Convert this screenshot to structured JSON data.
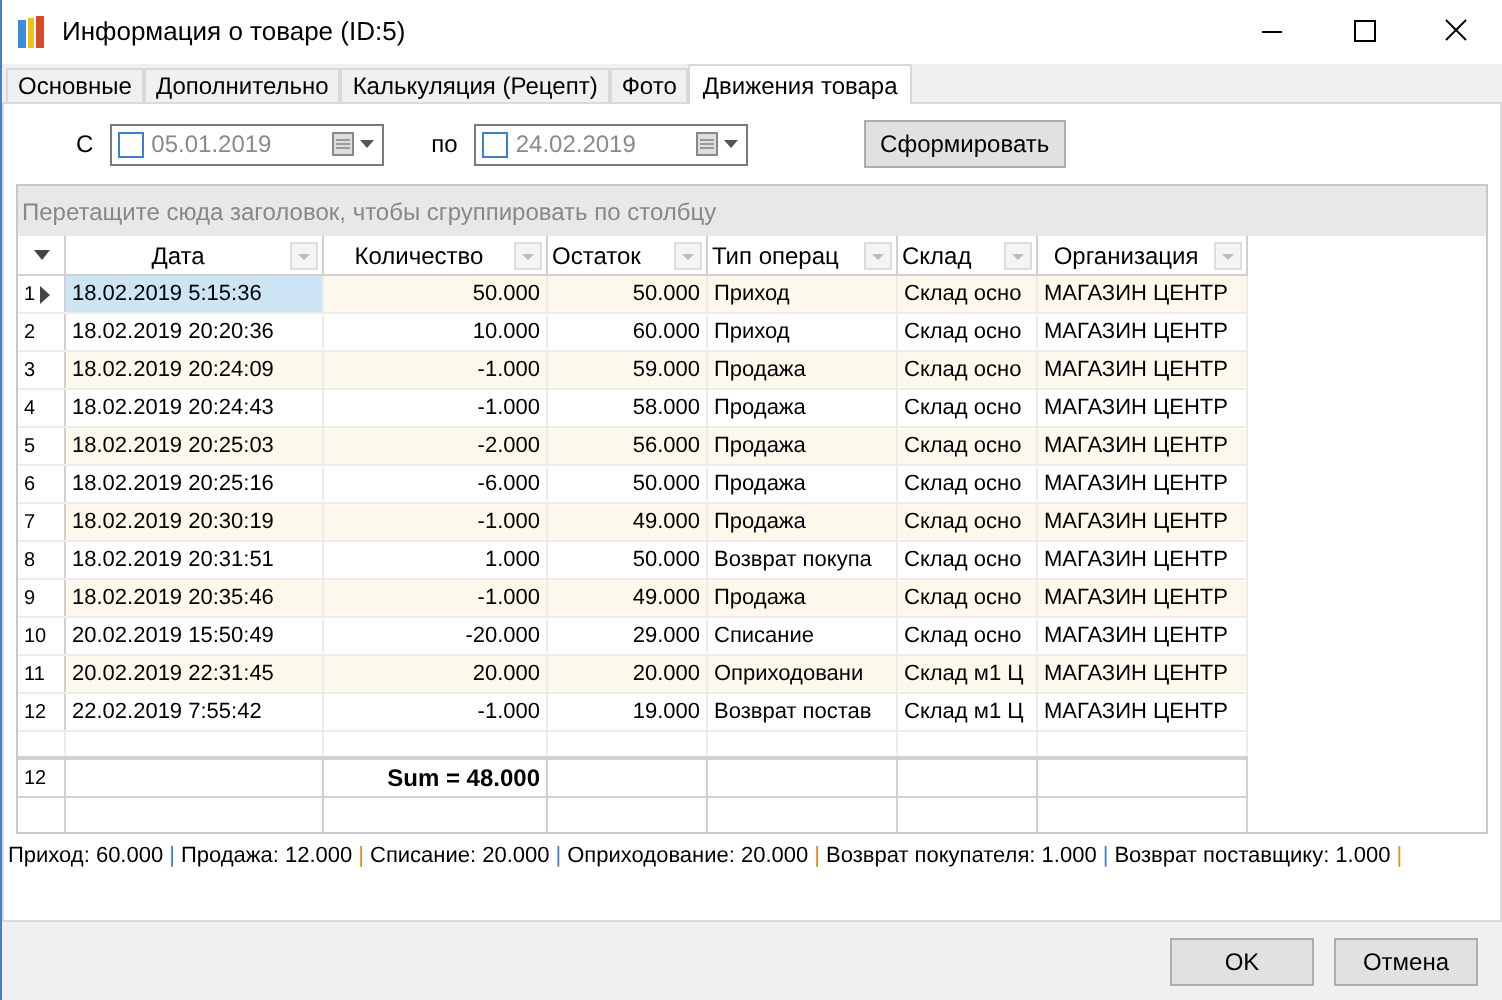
{
  "window": {
    "title": "Информация о товаре (ID:5)"
  },
  "tabs": [
    {
      "label": "Основные",
      "selected": false
    },
    {
      "label": "Дополнительно",
      "selected": false
    },
    {
      "label": "Калькуляция (Рецепт)",
      "selected": false
    },
    {
      "label": "Фото",
      "selected": false
    },
    {
      "label": "Движения товара",
      "selected": true
    }
  ],
  "filter": {
    "from_label": "С",
    "from_date": {
      "value": "05.01.2019",
      "checked": false
    },
    "to_label": "по",
    "to_date": {
      "value": "24.02.2019",
      "checked": false
    },
    "button": "Сформировать"
  },
  "group_panel": {
    "placeholder": "Перетащите сюда заголовок, чтобы сгруппировать по столбцу"
  },
  "table": {
    "columns": [
      "Дата",
      "Количество",
      "Остаток",
      "Тип операц",
      "Склад",
      "Организация"
    ],
    "rows": [
      {
        "number": "1",
        "selected": true,
        "cells": [
          "18.02.2019 5:15:36",
          "50.000",
          "50.000",
          "Приход",
          "Склад осно",
          "МАГАЗИН ЦЕНТР"
        ]
      },
      {
        "number": "2",
        "selected": false,
        "cells": [
          "18.02.2019 20:20:36",
          "10.000",
          "60.000",
          "Приход",
          "Склад осно",
          "МАГАЗИН ЦЕНТР"
        ]
      },
      {
        "number": "3",
        "selected": false,
        "cells": [
          "18.02.2019 20:24:09",
          "-1.000",
          "59.000",
          "Продажа",
          "Склад осно",
          "МАГАЗИН ЦЕНТР"
        ]
      },
      {
        "number": "4",
        "selected": false,
        "cells": [
          "18.02.2019 20:24:43",
          "-1.000",
          "58.000",
          "Продажа",
          "Склад осно",
          "МАГАЗИН ЦЕНТР"
        ]
      },
      {
        "number": "5",
        "selected": false,
        "cells": [
          "18.02.2019 20:25:03",
          "-2.000",
          "56.000",
          "Продажа",
          "Склад осно",
          "МАГАЗИН ЦЕНТР"
        ]
      },
      {
        "number": "6",
        "selected": false,
        "cells": [
          "18.02.2019 20:25:16",
          "-6.000",
          "50.000",
          "Продажа",
          "Склад осно",
          "МАГАЗИН ЦЕНТР"
        ]
      },
      {
        "number": "7",
        "selected": false,
        "cells": [
          "18.02.2019 20:30:19",
          "-1.000",
          "49.000",
          "Продажа",
          "Склад осно",
          "МАГАЗИН ЦЕНТР"
        ]
      },
      {
        "number": "8",
        "selected": false,
        "cells": [
          "18.02.2019 20:31:51",
          "1.000",
          "50.000",
          "Возврат покупа",
          "Склад осно",
          "МАГАЗИН ЦЕНТР"
        ]
      },
      {
        "number": "9",
        "selected": false,
        "cells": [
          "18.02.2019 20:35:46",
          "-1.000",
          "49.000",
          "Продажа",
          "Склад осно",
          "МАГАЗИН ЦЕНТР"
        ]
      },
      {
        "number": "10",
        "selected": false,
        "cells": [
          "20.02.2019 15:50:49",
          "-20.000",
          "29.000",
          "Списание",
          "Склад осно",
          "МАГАЗИН ЦЕНТР"
        ]
      },
      {
        "number": "11",
        "selected": false,
        "cells": [
          "20.02.2019 22:31:45",
          "20.000",
          "20.000",
          "Оприходовани",
          "Склад м1 Ц",
          "МАГАЗИН ЦЕНТР"
        ]
      },
      {
        "number": "12",
        "selected": false,
        "cells": [
          "22.02.2019 7:55:42",
          "-1.000",
          "19.000",
          "Возврат постав",
          "Склад м1 Ц",
          "МАГАЗИН ЦЕНТР"
        ]
      }
    ],
    "footer": {
      "count": "12",
      "sum": "Sum = 48.000"
    }
  },
  "summary": [
    {
      "text": "Приход: 60.000",
      "color": "#3c7fd0"
    },
    {
      "text": "Продажа: 12.000",
      "color": "#e08a1e"
    },
    {
      "text": "Списание: 20.000",
      "color": "#3c7fd0"
    },
    {
      "text": "Оприходование: 20.000",
      "color": "#e08a1e"
    },
    {
      "text": "Возврат покупателя: 1.000",
      "color": "#3c7fd0"
    },
    {
      "text": "Возврат поставщику: 1.000",
      "color": "#e08a1e"
    }
  ],
  "separator": "|",
  "buttons": [
    "OK",
    "Отмена"
  ]
}
